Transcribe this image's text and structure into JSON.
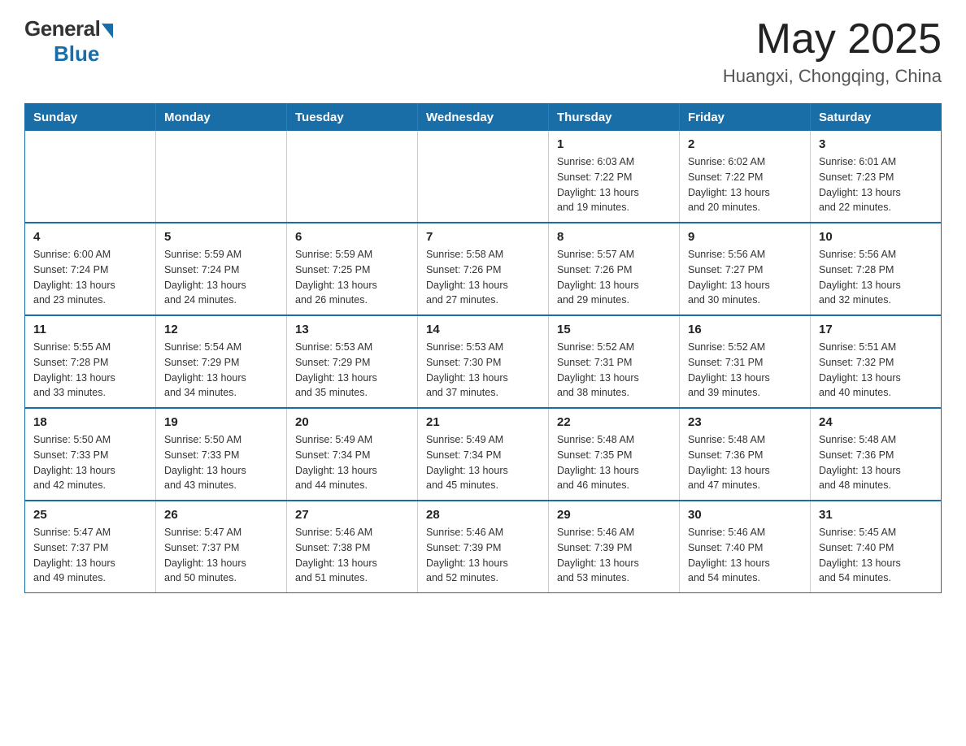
{
  "logo": {
    "general": "General",
    "blue": "Blue"
  },
  "title": {
    "month_year": "May 2025",
    "location": "Huangxi, Chongqing, China"
  },
  "days_of_week": [
    "Sunday",
    "Monday",
    "Tuesday",
    "Wednesday",
    "Thursday",
    "Friday",
    "Saturday"
  ],
  "weeks": [
    {
      "days": [
        {
          "number": "",
          "info": ""
        },
        {
          "number": "",
          "info": ""
        },
        {
          "number": "",
          "info": ""
        },
        {
          "number": "",
          "info": ""
        },
        {
          "number": "1",
          "info": "Sunrise: 6:03 AM\nSunset: 7:22 PM\nDaylight: 13 hours\nand 19 minutes."
        },
        {
          "number": "2",
          "info": "Sunrise: 6:02 AM\nSunset: 7:22 PM\nDaylight: 13 hours\nand 20 minutes."
        },
        {
          "number": "3",
          "info": "Sunrise: 6:01 AM\nSunset: 7:23 PM\nDaylight: 13 hours\nand 22 minutes."
        }
      ]
    },
    {
      "days": [
        {
          "number": "4",
          "info": "Sunrise: 6:00 AM\nSunset: 7:24 PM\nDaylight: 13 hours\nand 23 minutes."
        },
        {
          "number": "5",
          "info": "Sunrise: 5:59 AM\nSunset: 7:24 PM\nDaylight: 13 hours\nand 24 minutes."
        },
        {
          "number": "6",
          "info": "Sunrise: 5:59 AM\nSunset: 7:25 PM\nDaylight: 13 hours\nand 26 minutes."
        },
        {
          "number": "7",
          "info": "Sunrise: 5:58 AM\nSunset: 7:26 PM\nDaylight: 13 hours\nand 27 minutes."
        },
        {
          "number": "8",
          "info": "Sunrise: 5:57 AM\nSunset: 7:26 PM\nDaylight: 13 hours\nand 29 minutes."
        },
        {
          "number": "9",
          "info": "Sunrise: 5:56 AM\nSunset: 7:27 PM\nDaylight: 13 hours\nand 30 minutes."
        },
        {
          "number": "10",
          "info": "Sunrise: 5:56 AM\nSunset: 7:28 PM\nDaylight: 13 hours\nand 32 minutes."
        }
      ]
    },
    {
      "days": [
        {
          "number": "11",
          "info": "Sunrise: 5:55 AM\nSunset: 7:28 PM\nDaylight: 13 hours\nand 33 minutes."
        },
        {
          "number": "12",
          "info": "Sunrise: 5:54 AM\nSunset: 7:29 PM\nDaylight: 13 hours\nand 34 minutes."
        },
        {
          "number": "13",
          "info": "Sunrise: 5:53 AM\nSunset: 7:29 PM\nDaylight: 13 hours\nand 35 minutes."
        },
        {
          "number": "14",
          "info": "Sunrise: 5:53 AM\nSunset: 7:30 PM\nDaylight: 13 hours\nand 37 minutes."
        },
        {
          "number": "15",
          "info": "Sunrise: 5:52 AM\nSunset: 7:31 PM\nDaylight: 13 hours\nand 38 minutes."
        },
        {
          "number": "16",
          "info": "Sunrise: 5:52 AM\nSunset: 7:31 PM\nDaylight: 13 hours\nand 39 minutes."
        },
        {
          "number": "17",
          "info": "Sunrise: 5:51 AM\nSunset: 7:32 PM\nDaylight: 13 hours\nand 40 minutes."
        }
      ]
    },
    {
      "days": [
        {
          "number": "18",
          "info": "Sunrise: 5:50 AM\nSunset: 7:33 PM\nDaylight: 13 hours\nand 42 minutes."
        },
        {
          "number": "19",
          "info": "Sunrise: 5:50 AM\nSunset: 7:33 PM\nDaylight: 13 hours\nand 43 minutes."
        },
        {
          "number": "20",
          "info": "Sunrise: 5:49 AM\nSunset: 7:34 PM\nDaylight: 13 hours\nand 44 minutes."
        },
        {
          "number": "21",
          "info": "Sunrise: 5:49 AM\nSunset: 7:34 PM\nDaylight: 13 hours\nand 45 minutes."
        },
        {
          "number": "22",
          "info": "Sunrise: 5:48 AM\nSunset: 7:35 PM\nDaylight: 13 hours\nand 46 minutes."
        },
        {
          "number": "23",
          "info": "Sunrise: 5:48 AM\nSunset: 7:36 PM\nDaylight: 13 hours\nand 47 minutes."
        },
        {
          "number": "24",
          "info": "Sunrise: 5:48 AM\nSunset: 7:36 PM\nDaylight: 13 hours\nand 48 minutes."
        }
      ]
    },
    {
      "days": [
        {
          "number": "25",
          "info": "Sunrise: 5:47 AM\nSunset: 7:37 PM\nDaylight: 13 hours\nand 49 minutes."
        },
        {
          "number": "26",
          "info": "Sunrise: 5:47 AM\nSunset: 7:37 PM\nDaylight: 13 hours\nand 50 minutes."
        },
        {
          "number": "27",
          "info": "Sunrise: 5:46 AM\nSunset: 7:38 PM\nDaylight: 13 hours\nand 51 minutes."
        },
        {
          "number": "28",
          "info": "Sunrise: 5:46 AM\nSunset: 7:39 PM\nDaylight: 13 hours\nand 52 minutes."
        },
        {
          "number": "29",
          "info": "Sunrise: 5:46 AM\nSunset: 7:39 PM\nDaylight: 13 hours\nand 53 minutes."
        },
        {
          "number": "30",
          "info": "Sunrise: 5:46 AM\nSunset: 7:40 PM\nDaylight: 13 hours\nand 54 minutes."
        },
        {
          "number": "31",
          "info": "Sunrise: 5:45 AM\nSunset: 7:40 PM\nDaylight: 13 hours\nand 54 minutes."
        }
      ]
    }
  ]
}
